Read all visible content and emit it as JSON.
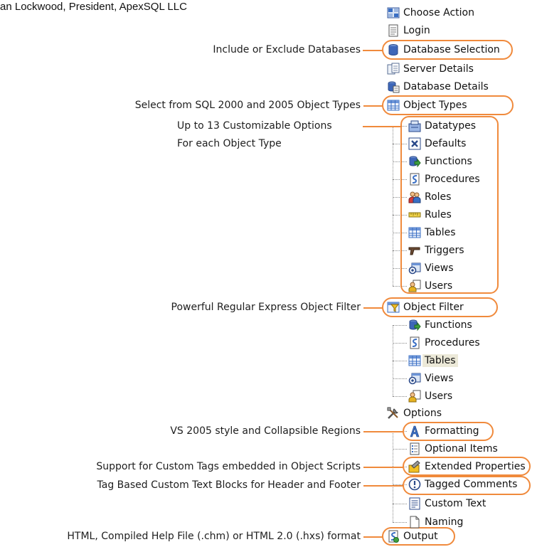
{
  "caption": "an Lockwood, President, ApexSQL LLC",
  "tree": {
    "choose_action": "Choose Action",
    "login": "Login",
    "database_selection": "Database Selection",
    "server_details": "Server Details",
    "database_details": "Database Details",
    "object_types": "Object Types",
    "object_type_children": [
      "Datatypes",
      "Defaults",
      "Functions",
      "Procedures",
      "Roles",
      "Rules",
      "Tables",
      "Triggers",
      "Views",
      "Users"
    ],
    "object_filter": "Object Filter",
    "object_filter_children": [
      "Functions",
      "Procedures",
      "Tables",
      "Views",
      "Users"
    ],
    "options": "Options",
    "options_children": [
      "Formatting",
      "Optional Items",
      "Extended Properties",
      "Tagged Comments",
      "Custom Text",
      "Naming"
    ],
    "output": "Output"
  },
  "annotations": {
    "database_selection": "Include or Exclude Databases",
    "object_types": "Select from SQL 2000 and 2005 Object Types",
    "options_line1": "Up to 13 Customizable Options",
    "options_line2": "For each Object Type",
    "object_filter": "Powerful Regular Express Object Filter",
    "formatting": "VS 2005 style and Collapsible Regions",
    "tagged_comments": "Support for Custom Tags embedded in Object Scripts",
    "custom_text": "Tag Based Custom Text Blocks for Header and Footer",
    "output": "HTML, Compiled Help File (.chm) or HTML 2.0 (.hxs) format"
  },
  "colors": {
    "highlight": "#f08a3c",
    "selection": "#ece9d8"
  }
}
